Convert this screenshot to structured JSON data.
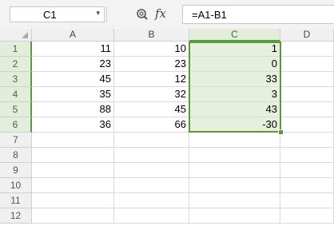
{
  "formula_bar": {
    "name_box": "C1",
    "name_box_arrow": "▾",
    "fx_label": "fx",
    "formula": "=A1-B1"
  },
  "columns": [
    "A",
    "B",
    "C",
    "D"
  ],
  "rows": [
    "1",
    "2",
    "3",
    "4",
    "5",
    "6",
    "7",
    "8",
    "9",
    "10",
    "11",
    "12"
  ],
  "cells": [
    [
      "11",
      "10",
      "1"
    ],
    [
      "23",
      "23",
      "0"
    ],
    [
      "45",
      "12",
      "33"
    ],
    [
      "35",
      "32",
      "3"
    ],
    [
      "88",
      "45",
      "43"
    ],
    [
      "36",
      "66",
      "-30"
    ]
  ],
  "selected_column": "C",
  "selected_rows": [
    "1",
    "2",
    "3",
    "4",
    "5",
    "6"
  ],
  "colors": {
    "selection_border": "#5b9a3c",
    "selection_fill": "#e5f1dd"
  }
}
